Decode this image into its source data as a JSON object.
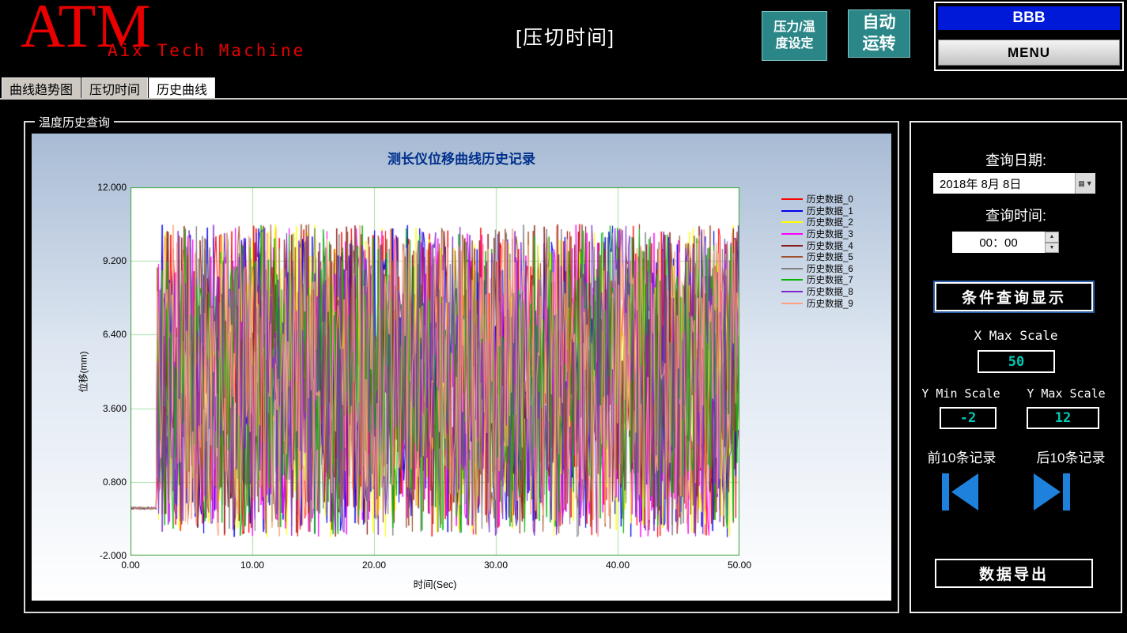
{
  "header": {
    "logo": "ATM",
    "logo_sub": "Aix Tech Machine",
    "title": "[压切时间]",
    "pressure_temp_button": "压力/温\n度设定",
    "auto_run_button": "自动\n运转",
    "banner": "BBB",
    "menu_button": "MENU"
  },
  "tabs": [
    {
      "label": "曲线趋势图",
      "selected": false
    },
    {
      "label": "压切时间",
      "selected": false
    },
    {
      "label": "历史曲线",
      "selected": true
    }
  ],
  "panel": {
    "title": "温度历史查询"
  },
  "chart_data": {
    "type": "line",
    "title": "测长仪位移曲线历史记录",
    "xlabel": "时间(Sec)",
    "ylabel": "位移(mm)",
    "xlim": [
      0,
      50
    ],
    "ylim": [
      -2,
      12
    ],
    "x_ticks": [
      0,
      10,
      20,
      30,
      40,
      50
    ],
    "y_ticks": [
      12.0,
      9.2,
      6.4,
      3.6,
      0.8,
      -2.0
    ],
    "x_tick_labels": [
      "0.00",
      "10.00",
      "20.00",
      "30.00",
      "40.00",
      "50.00"
    ],
    "y_tick_labels": [
      "12.000",
      "9.200",
      "6.400",
      "3.600",
      "0.800",
      "-2.000"
    ],
    "grid": true,
    "legend_position": "top-right",
    "series": [
      {
        "name": "历史数据_0",
        "color": "#ff0000"
      },
      {
        "name": "历史数据_1",
        "color": "#0000ee"
      },
      {
        "name": "历史数据_2",
        "color": "#ffff00"
      },
      {
        "name": "历史数据_3",
        "color": "#ff00ff"
      },
      {
        "name": "历史数据_4",
        "color": "#8b1a1a"
      },
      {
        "name": "历史数据_5",
        "color": "#a0522d"
      },
      {
        "name": "历史数据_6",
        "color": "#808080"
      },
      {
        "name": "历史数据_7",
        "color": "#00b400"
      },
      {
        "name": "历史数据_8",
        "color": "#7d26cd"
      },
      {
        "name": "历史数据_9",
        "color": "#ffa07a"
      }
    ],
    "description": "10 history series of dense random displacement noise: each trace is flat near -0.2 mm from 0 to ~2 s, then oscillates rapidly between about -1.3 and 10.6 mm until 50 s.",
    "generation": {
      "points_per_series": 500,
      "flat_until_sec": 2.2,
      "flat_value": -0.2,
      "noise_min": -1.3,
      "noise_max": 10.6,
      "seed": 7
    }
  },
  "sidebar": {
    "query_date_label": "查询日期:",
    "date_value": "2018年 8月 8日",
    "query_time_label": "查询时间:",
    "time_value": "00：00",
    "query_button": "条件查询显示",
    "x_max_label": "X Max Scale",
    "x_max_value": "50",
    "y_min_label": "Y Min Scale",
    "y_min_value": "-2",
    "y_max_label": "Y Max Scale",
    "y_max_value": "12",
    "prev_label": "前10条记录",
    "next_label": "后10条记录",
    "export_button": "数据导出"
  },
  "icons": {
    "calendar": "▦",
    "dropdown_arrow": "▼",
    "spin_up": "▲",
    "spin_down": "▼"
  },
  "colors": {
    "accent_teal_button": "#2b8688",
    "banner_blue": "#0018d8",
    "value_text": "#00c8b4",
    "nav_arrow_blue": "#1e82dc",
    "logo_red": "#e80000",
    "chart_title_navy": "#00308c",
    "grid_green": "#a9e0a9"
  }
}
